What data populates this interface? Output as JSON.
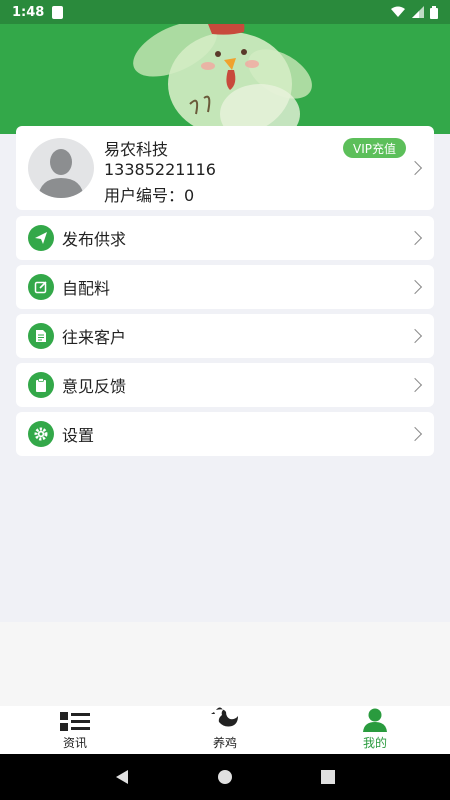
{
  "status_bar": {
    "time": "1:48"
  },
  "profile": {
    "name": "易农科技",
    "phone": "13385221116",
    "user_id": "用户编号：0",
    "vip_label": "VIP充值"
  },
  "menu": {
    "items": [
      {
        "label": "发布供求",
        "icon": "paper-plane-icon"
      },
      {
        "label": "自配料",
        "icon": "edit-icon"
      },
      {
        "label": "往来客户",
        "icon": "document-icon"
      },
      {
        "label": "意见反馈",
        "icon": "clipboard-icon"
      },
      {
        "label": "设置",
        "icon": "gear-icon"
      }
    ]
  },
  "tabs": [
    {
      "label": "资讯",
      "icon": "list-icon",
      "active": false
    },
    {
      "label": "养鸡",
      "icon": "chicken-icon",
      "active": false
    },
    {
      "label": "我的",
      "icon": "person-icon",
      "active": true
    }
  ],
  "colors": {
    "brand_green": "#33a849",
    "active_tab": "#2a9b3e",
    "vip_badge": "#5cbf5a"
  }
}
